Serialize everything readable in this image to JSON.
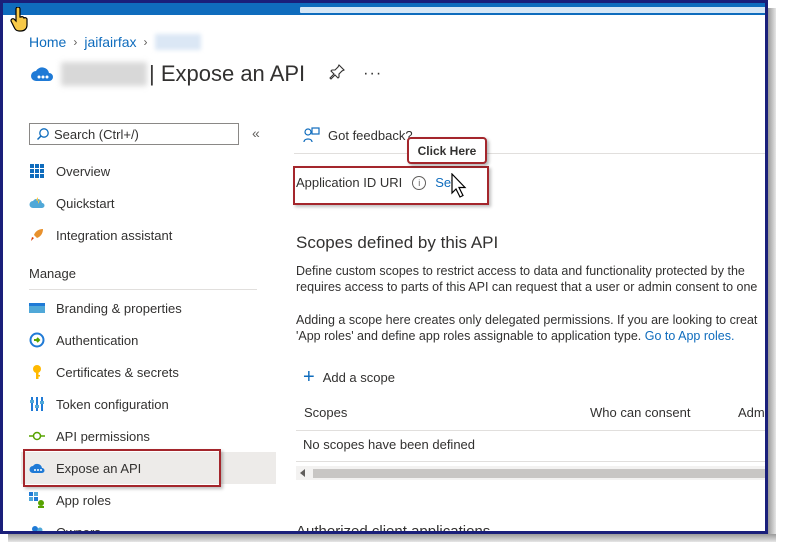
{
  "breadcrumb": {
    "home": "Home",
    "tenant": "jaifairfax"
  },
  "header": {
    "title": "| Expose an API",
    "pin_label": "📌",
    "more_label": "···"
  },
  "sidebar": {
    "search_placeholder": "Search (Ctrl+/)",
    "collapse_label": "«",
    "section_manage": "Manage",
    "items": [
      {
        "label": "Overview",
        "icon": "grid-icon"
      },
      {
        "label": "Quickstart",
        "icon": "cloud-icon"
      },
      {
        "label": "Integration assistant",
        "icon": "rocket-icon"
      },
      {
        "label": "Branding & properties",
        "icon": "branding-icon"
      },
      {
        "label": "Authentication",
        "icon": "authentication-icon"
      },
      {
        "label": "Certificates & secrets",
        "icon": "key-icon"
      },
      {
        "label": "Token configuration",
        "icon": "token-icon"
      },
      {
        "label": "API permissions",
        "icon": "api-permissions-icon"
      },
      {
        "label": "Expose an API",
        "icon": "cloud-api-icon",
        "active": true
      },
      {
        "label": "App roles",
        "icon": "app-roles-icon"
      },
      {
        "label": "Owners",
        "icon": "owners-icon"
      }
    ]
  },
  "main": {
    "feedback": "Got feedback?",
    "app_id_label": "Application ID URI",
    "set_link": "Set",
    "callout": "Click Here",
    "scopes_heading": "Scopes defined by this API",
    "para1_line1": "Define custom scopes to restrict access to data and functionality protected by the",
    "para1_line2": "requires access to parts of this API can request that a user or admin consent to one",
    "para2_line1": "Adding a scope here creates only delegated permissions. If you are looking to creat",
    "para2_line2_text": "'App roles' and define app roles assignable to application type.",
    "para2_link": "Go to App roles.",
    "add_scope": "Add a scope",
    "table": {
      "headers": [
        "Scopes",
        "Who can consent",
        "Adm"
      ],
      "empty": "No scopes have been defined"
    },
    "next_heading": "Authorized client applications"
  },
  "colors": {
    "accent": "#0f6cbd",
    "highlight": "#a4262c",
    "frame": "#1a1f7a"
  }
}
